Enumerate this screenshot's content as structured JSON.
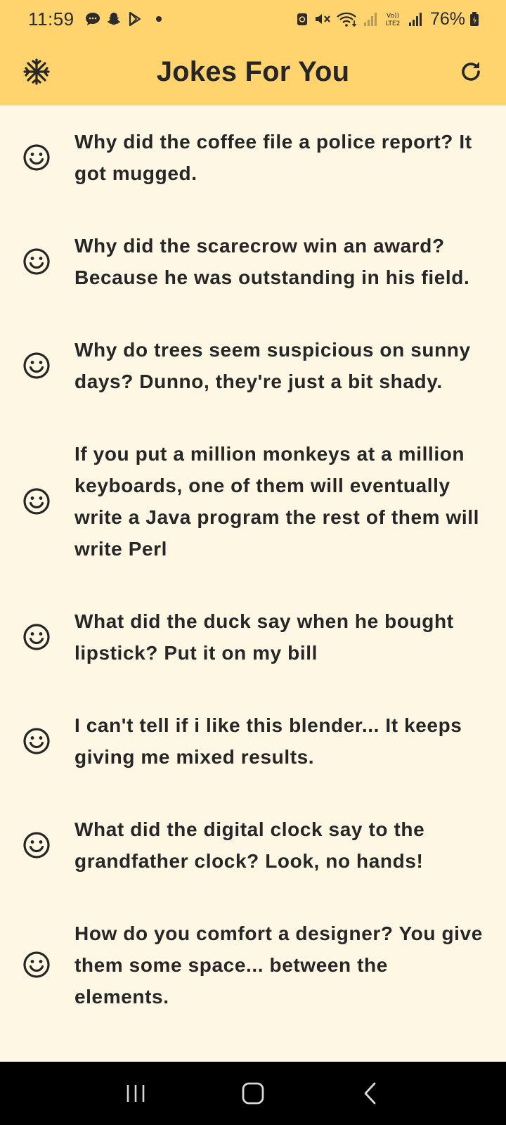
{
  "status_bar": {
    "time": "11:59",
    "battery_percent": "76%",
    "left_icons": [
      "message-icon",
      "snapchat-icon",
      "play-store-icon"
    ],
    "right_icons": [
      "sync-icon",
      "mute-icon",
      "wifi-icon",
      "signal-icon",
      "volte-icon",
      "signal-icon",
      "battery-icon"
    ]
  },
  "app_bar": {
    "title": "Jokes For You",
    "left_icon": "snowflake-icon",
    "right_icon": "refresh-icon",
    "background": "#ffd36e"
  },
  "jokes": [
    {
      "icon": "smiley-icon",
      "text": "Why did the coffee file a police report? It got mugged."
    },
    {
      "icon": "smiley-icon",
      "text": "Why did the scarecrow win an award? Because he was outstanding in his field."
    },
    {
      "icon": "smiley-icon",
      "text": "Why do trees seem suspicious on sunny days? Dunno, they're just a bit shady."
    },
    {
      "icon": "smiley-icon",
      "text": "If you put a million monkeys at a million keyboards, one of them will eventually write a Java program the rest of them will write Perl"
    },
    {
      "icon": "smiley-icon",
      "text": "What did the duck say when he bought lipstick? Put it on my bill"
    },
    {
      "icon": "smiley-icon",
      "text": "I can't tell if i like this blender... It keeps giving me mixed results."
    },
    {
      "icon": "smiley-icon",
      "text": "What did the digital clock say to the grandfather clock? Look, no hands!"
    },
    {
      "icon": "smiley-icon",
      "text": "How do you comfort a designer? You give them some space... between the elements."
    }
  ],
  "nav_bar": {
    "buttons": [
      "recent-apps-icon",
      "home-icon",
      "back-icon"
    ]
  },
  "colors": {
    "accent": "#ffd36e",
    "background": "#fdf7e4",
    "text": "#262626"
  }
}
